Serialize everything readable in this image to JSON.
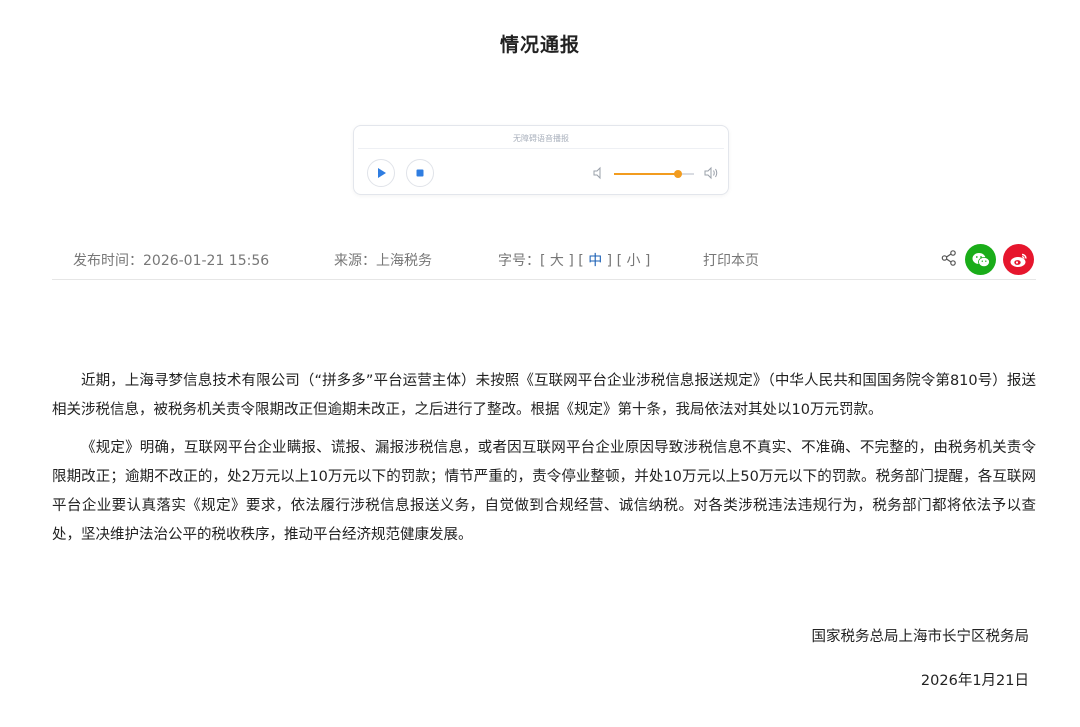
{
  "title": "情况通报",
  "player": {
    "label": "无障碍语音播报",
    "volume_level": 0.8
  },
  "meta": {
    "date_label": "发布时间：",
    "date_value": "2026-01-21 15:56",
    "source_label": "来源：",
    "source_value": "上海税务",
    "fontsize_label": "字号：",
    "fontsize_options": [
      "大",
      "中",
      "小"
    ],
    "fontsize_selected": "中",
    "print_label": "打印本页"
  },
  "content": {
    "paragraphs": [
      "近期，上海寻梦信息技术有限公司（“拼多多”平台运营主体）未按照《互联网平台企业涉税信息报送规定》（中华人民共和国国务院令第810号）报送相关涉税信息，被税务机关责令限期改正但逾期未改正，之后进行了整改。根据《规定》第十条，我局依法对其处以10万元罚款。",
      "《规定》明确，互联网平台企业瞒报、谎报、漏报涉税信息，或者因互联网平台企业原因导致涉税信息不真实、不准确、不完整的，由税务机关责令限期改正；逾期不改正的，处2万元以上10万元以下的罚款；情节严重的，责令停业整顿，并处10万元以上50万元以下的罚款。税务部门提醒，各互联网平台企业要认真落实《规定》要求，依法履行涉税信息报送义务，自觉做到合规经营、诚信纳税。对各类涉税违法违规行为，税务部门都将依法予以查处，坚决维护法治公平的税收秩序，推动平台经济规范健康发展。"
    ],
    "signature": "国家税务总局上海市长宁区税务局",
    "sign_date": "2026年1月21日"
  },
  "colors": {
    "accent_blue": "#1a5fb4",
    "player_orange": "#f29c1f",
    "wechat_green": "#1aad19",
    "weibo_red": "#e6162d"
  },
  "icons": [
    "play-icon",
    "stop-icon",
    "volume-low-icon",
    "volume-high-icon",
    "share-icon",
    "wechat-icon",
    "weibo-icon"
  ]
}
